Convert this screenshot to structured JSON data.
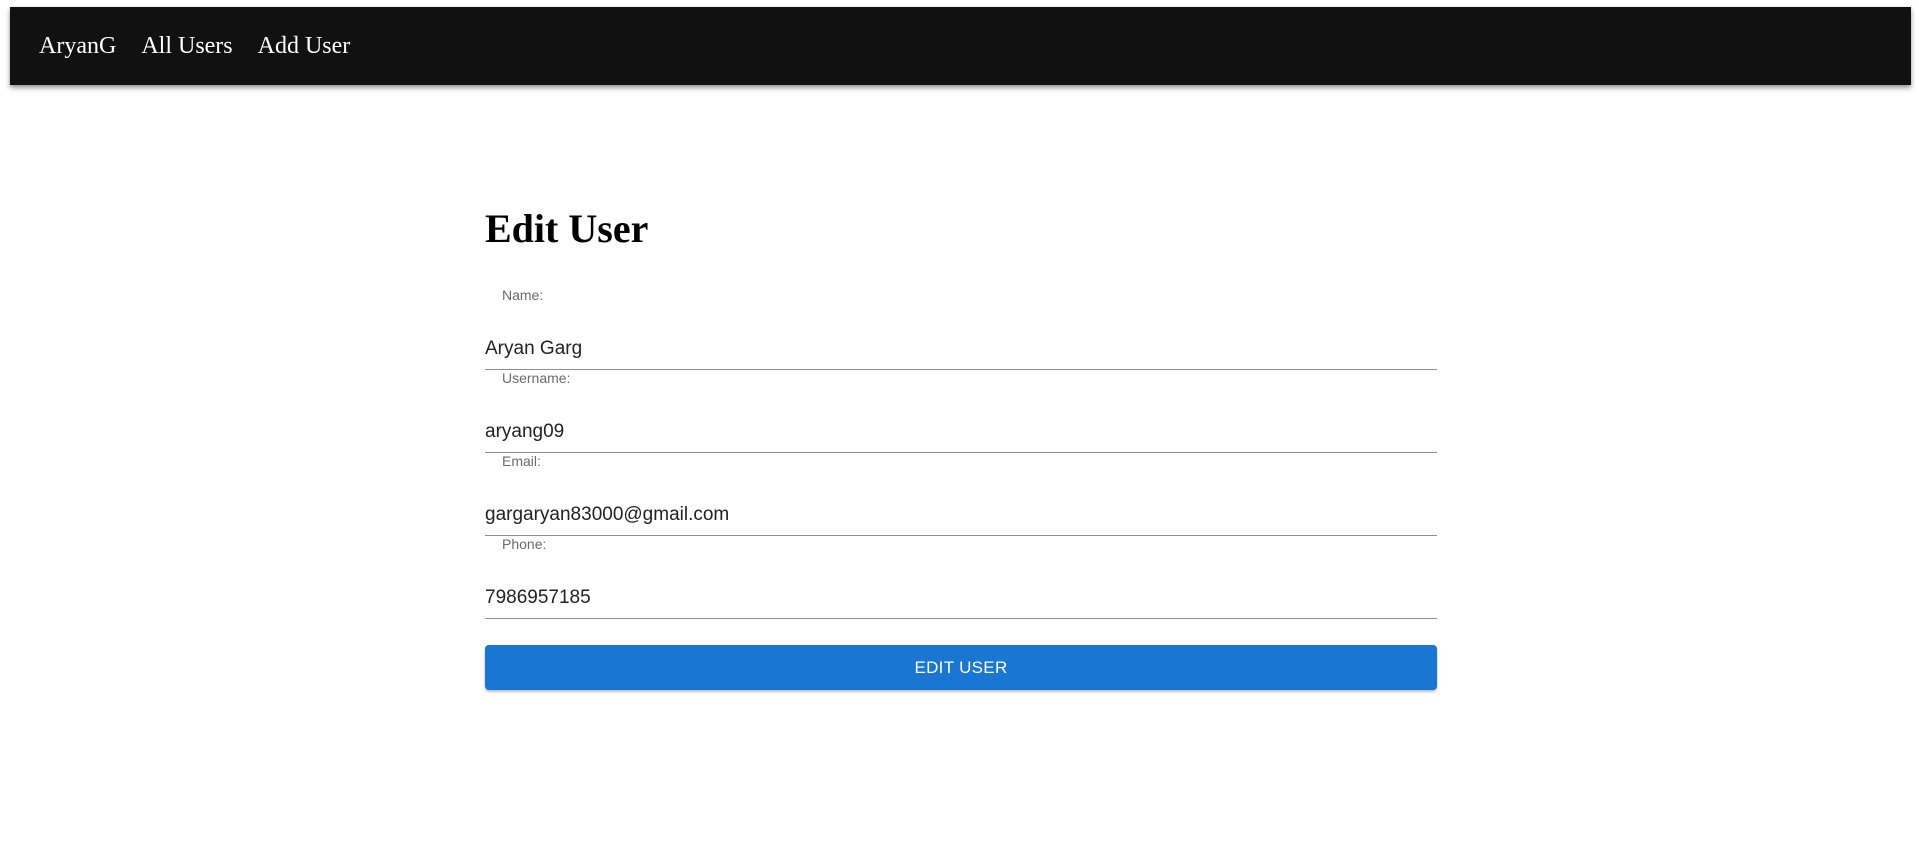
{
  "navbar": {
    "brand": "AryanG",
    "links": [
      "All Users",
      "Add User"
    ],
    "background_color": "#111111"
  },
  "page": {
    "title": "Edit User"
  },
  "form": {
    "fields": [
      {
        "label": "Name:",
        "value": "Aryan Garg"
      },
      {
        "label": "Username:",
        "value": "aryang09"
      },
      {
        "label": "Email:",
        "value": "gargaryan83000@gmail.com"
      },
      {
        "label": "Phone:",
        "value": "7986957185"
      }
    ],
    "submit_label": "EDIT USER",
    "accent_color": "#1976d2"
  }
}
